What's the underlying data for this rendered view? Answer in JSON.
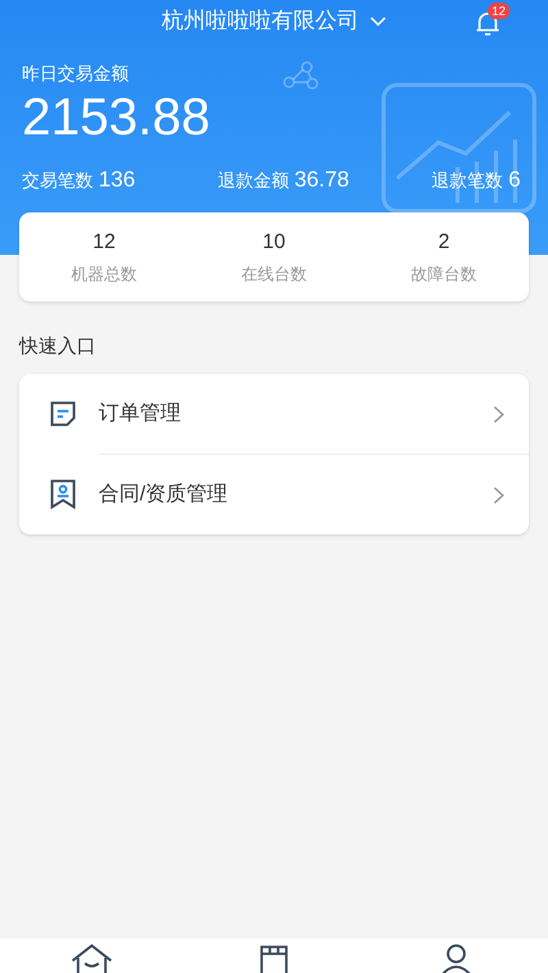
{
  "header": {
    "company": "杭州啦啦啦有限公司",
    "badge": "12"
  },
  "summary": {
    "label": "昨日交易金额",
    "amount": "2153.88",
    "stats": [
      {
        "label": "交易笔数",
        "value": "136"
      },
      {
        "label": "退款金额",
        "value": "36.78"
      },
      {
        "label": "退款笔数",
        "value": "6"
      }
    ]
  },
  "machines": [
    {
      "value": "12",
      "label": "机器总数"
    },
    {
      "value": "10",
      "label": "在线台数"
    },
    {
      "value": "2",
      "label": "故障台数"
    }
  ],
  "quick_entry": {
    "title": "快速入口",
    "items": [
      {
        "kind": "order",
        "label": "订单管理"
      },
      {
        "kind": "contract",
        "label": "合同/资质管理"
      }
    ]
  },
  "tab_bar": [
    {
      "kind": "home"
    },
    {
      "kind": "store"
    },
    {
      "kind": "user"
    }
  ]
}
